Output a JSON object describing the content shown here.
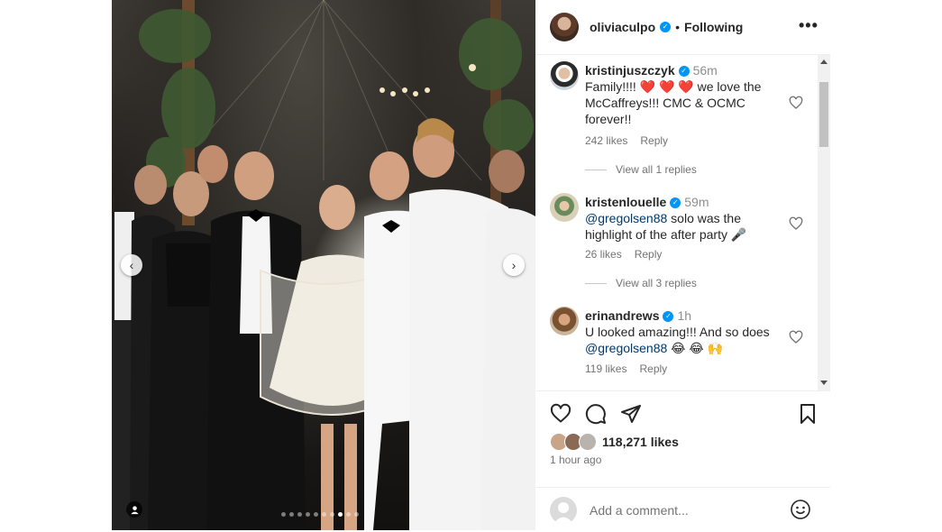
{
  "post": {
    "image_alt": "",
    "carousel": {
      "total": 10,
      "active_index": 7
    },
    "nav_prev": "‹",
    "nav_next": "›"
  },
  "header": {
    "username": "oliviaculpo",
    "separator": "•",
    "follow_state": "Following",
    "more_label": "•••"
  },
  "comments": [
    {
      "username": "kristinjuszczyk",
      "time": "56m",
      "text_before": "Family!!!! ",
      "hearts": "❤️ ❤️ ❤️",
      "text_after": " we love the McCaffreys!!! CMC & OCMC forever!!",
      "likes": "242 likes",
      "reply": "Reply",
      "view_replies": "View all 1 replies"
    },
    {
      "username": "kristenlouelle",
      "time": "59m",
      "mention": "@gregolsen88",
      "text": " solo was the highlight of the after party 🎤",
      "likes": "26 likes",
      "reply": "Reply",
      "view_replies": "View all 3 replies"
    },
    {
      "username": "erinandrews",
      "time": "1h",
      "text_before": "U looked amazing!!! And so does ",
      "mention": "@gregolsen88",
      "text_after": " 😂 😂 🙌",
      "likes": "119 likes",
      "reply": "Reply"
    }
  ],
  "engagement": {
    "likes": "118,271 likes",
    "time_ago": "1 hour ago"
  },
  "add_comment": {
    "placeholder": "Add a comment..."
  },
  "colors": {
    "verified": "#0095f6",
    "mention": "#00376b",
    "meta": "#737373"
  }
}
